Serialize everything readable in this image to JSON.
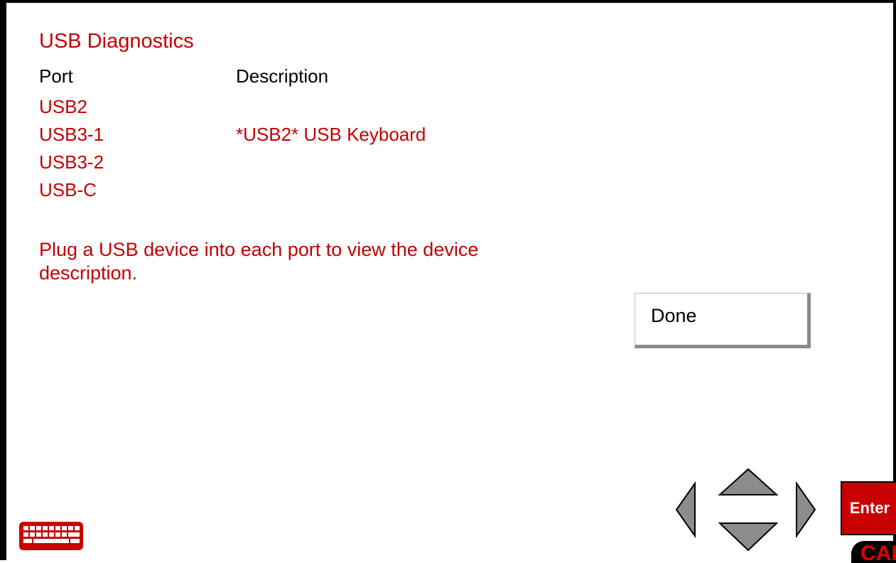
{
  "title": "USB Diagnostics",
  "columns": {
    "port": "Port",
    "description": "Description"
  },
  "rows": [
    {
      "port": "USB2",
      "description": ""
    },
    {
      "port": "USB3-1",
      "description": "*USB2* USB Keyboard"
    },
    {
      "port": "USB3-2",
      "description": ""
    },
    {
      "port": "USB-C",
      "description": ""
    }
  ],
  "message": "Plug a USB device into each port to view the device description.",
  "buttons": {
    "done": "Done",
    "enter": "Enter"
  },
  "logo": "CAL",
  "icons": {
    "keyboard": "keyboard-icon",
    "up": "arrow-up-icon",
    "down": "arrow-down-icon",
    "left": "arrow-left-icon",
    "right": "arrow-right-icon"
  },
  "colors": {
    "accent_red": "#c40000",
    "arrow_gray": "#8c8c8c"
  }
}
